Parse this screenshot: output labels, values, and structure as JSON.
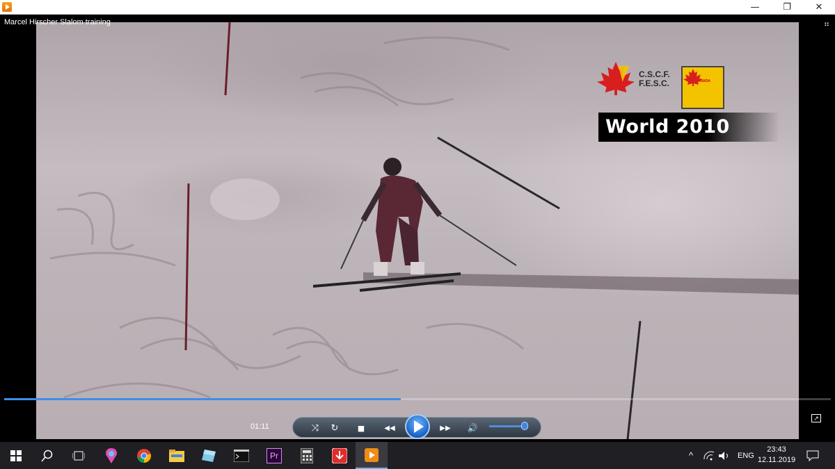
{
  "window": {
    "minimize_glyph": "—",
    "maximize_glyph": "❐",
    "close_glyph": "✕"
  },
  "player": {
    "video_title": "Marcel Hirscher Slalom training",
    "fullscreen_glyph": "⠶",
    "overlay": {
      "org_line1": "C.S.C.F.",
      "org_line2": "F.E.S.C.",
      "badge_text": "CANADA",
      "banner_text": "World 2010"
    },
    "time": "01:11",
    "progress": 0.48,
    "volume": 0.9,
    "controls": {
      "shuffle_glyph": "⤨",
      "repeat_glyph": "↻",
      "stop_glyph": "■",
      "prev_glyph": "◀◀",
      "next_glyph": "▶▶",
      "volume_glyph": "🔊"
    },
    "mini_mode_glyph": "↗"
  },
  "taskbar": {
    "apps": [
      {
        "name": "start-icon"
      },
      {
        "name": "search-icon"
      },
      {
        "name": "task-view-icon"
      },
      {
        "name": "paint-3d-icon"
      },
      {
        "name": "chrome-icon"
      },
      {
        "name": "file-explorer-icon"
      },
      {
        "name": "app-icon"
      },
      {
        "name": "terminal-icon"
      },
      {
        "name": "premiere-pro-icon",
        "label": "Pr"
      },
      {
        "name": "calculator-icon"
      },
      {
        "name": "downloader-icon"
      },
      {
        "name": "media-player-icon"
      }
    ],
    "tray": {
      "chevron": "^",
      "language": "ENG"
    },
    "clock": {
      "time": "23:43",
      "date": "12.11.2019"
    }
  },
  "colors": {
    "accent": "#3f8de8",
    "taskbar": "#1f1f24",
    "snow": "#c5bcc1",
    "flag_red": "#d81e1e",
    "badge_yellow": "#f4c300"
  }
}
